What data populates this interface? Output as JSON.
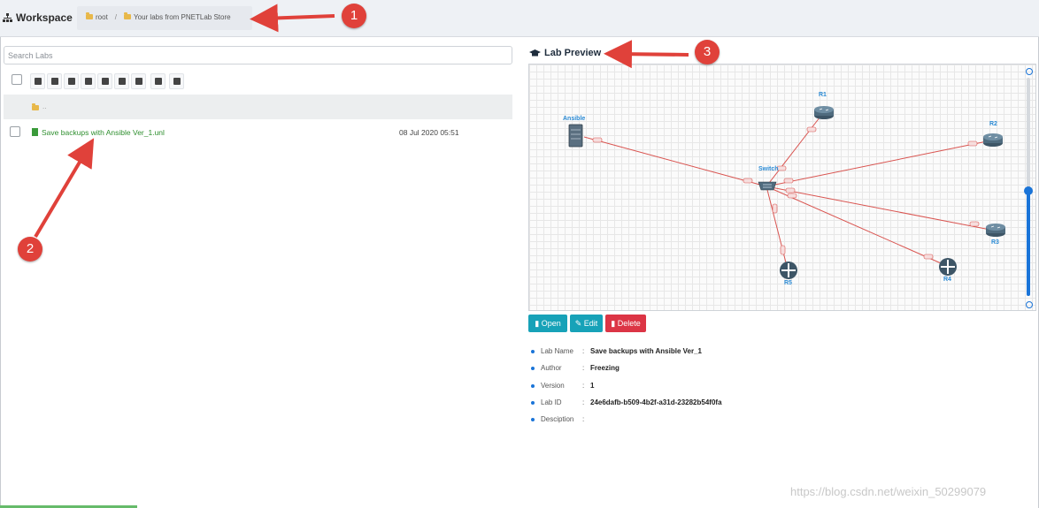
{
  "header": {
    "title": "Workspace",
    "breadcrumb": [
      "root",
      "Your labs from PNETLab Store"
    ],
    "separator": "/"
  },
  "left": {
    "search_placeholder": "Search Labs",
    "toolbar_icons": [
      "folder-open-icon",
      "file-icon",
      "pencil-icon",
      "move-icon",
      "trash-icon",
      "download-icon",
      "upload-icon",
      "stop-icon",
      "refresh-icon"
    ],
    "parent_label": "..",
    "lab": {
      "name": "Save backups with Ansible Ver_1.unl",
      "date": "08 Jul 2020 05:51"
    }
  },
  "preview": {
    "title": "Lab Preview",
    "nodes": [
      "Ansible",
      "R1",
      "R2",
      "Switch",
      "R3",
      "R4",
      "R5"
    ],
    "zoom_level": 0.48,
    "buttons": {
      "open": "Open",
      "edit": "Edit",
      "delete": "Delete"
    },
    "info": [
      {
        "key": "Lab Name",
        "value": "Save backups with Ansible Ver_1"
      },
      {
        "key": "Author",
        "value": "Freezing"
      },
      {
        "key": "Version",
        "value": "1"
      },
      {
        "key": "Lab ID",
        "value": "24e6dafb-b509-4b2f-a31d-23282b54f0fa"
      },
      {
        "key": "Desciption",
        "value": ""
      }
    ]
  },
  "annotations": [
    "1",
    "2",
    "3"
  ],
  "watermark": "https://blog.csdn.net/weixin_50299079",
  "colors": {
    "accent": "#1a74d8",
    "link_red": "#e05c5c",
    "teal": "#17a2b8",
    "danger": "#dc3545",
    "lab_green": "#2f8f2f"
  }
}
